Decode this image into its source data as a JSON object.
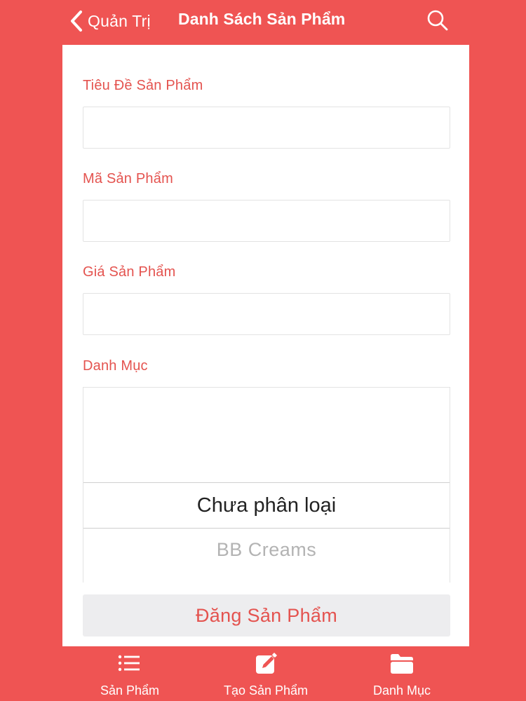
{
  "navbar": {
    "back_label": "Quản Trị",
    "title": "Danh Sách Sản Phẩm"
  },
  "form": {
    "title_label": "Tiêu Đề Sản Phẩm",
    "title_value": "",
    "code_label": "Mã Sản Phẩm",
    "code_value": "",
    "price_label": "Giá Sản Phẩm",
    "price_value": "",
    "category_label": "Danh Mục",
    "category_options": [
      "Chưa phân loại",
      "BB Creams"
    ],
    "selected_category": "Chưa phân loại",
    "submit_label": "Đăng Sản Phẩm"
  },
  "tabs": [
    {
      "label": "Sản Phẩm",
      "icon": "list-icon"
    },
    {
      "label": "Tạo Sản Phẩm",
      "icon": "edit-icon"
    },
    {
      "label": "Danh Mục",
      "icon": "folder-icon"
    }
  ],
  "colors": {
    "background": "#EF5453",
    "accent": "#E4534F",
    "card": "#FFFFFF",
    "button_bg": "#EDEDEF"
  }
}
